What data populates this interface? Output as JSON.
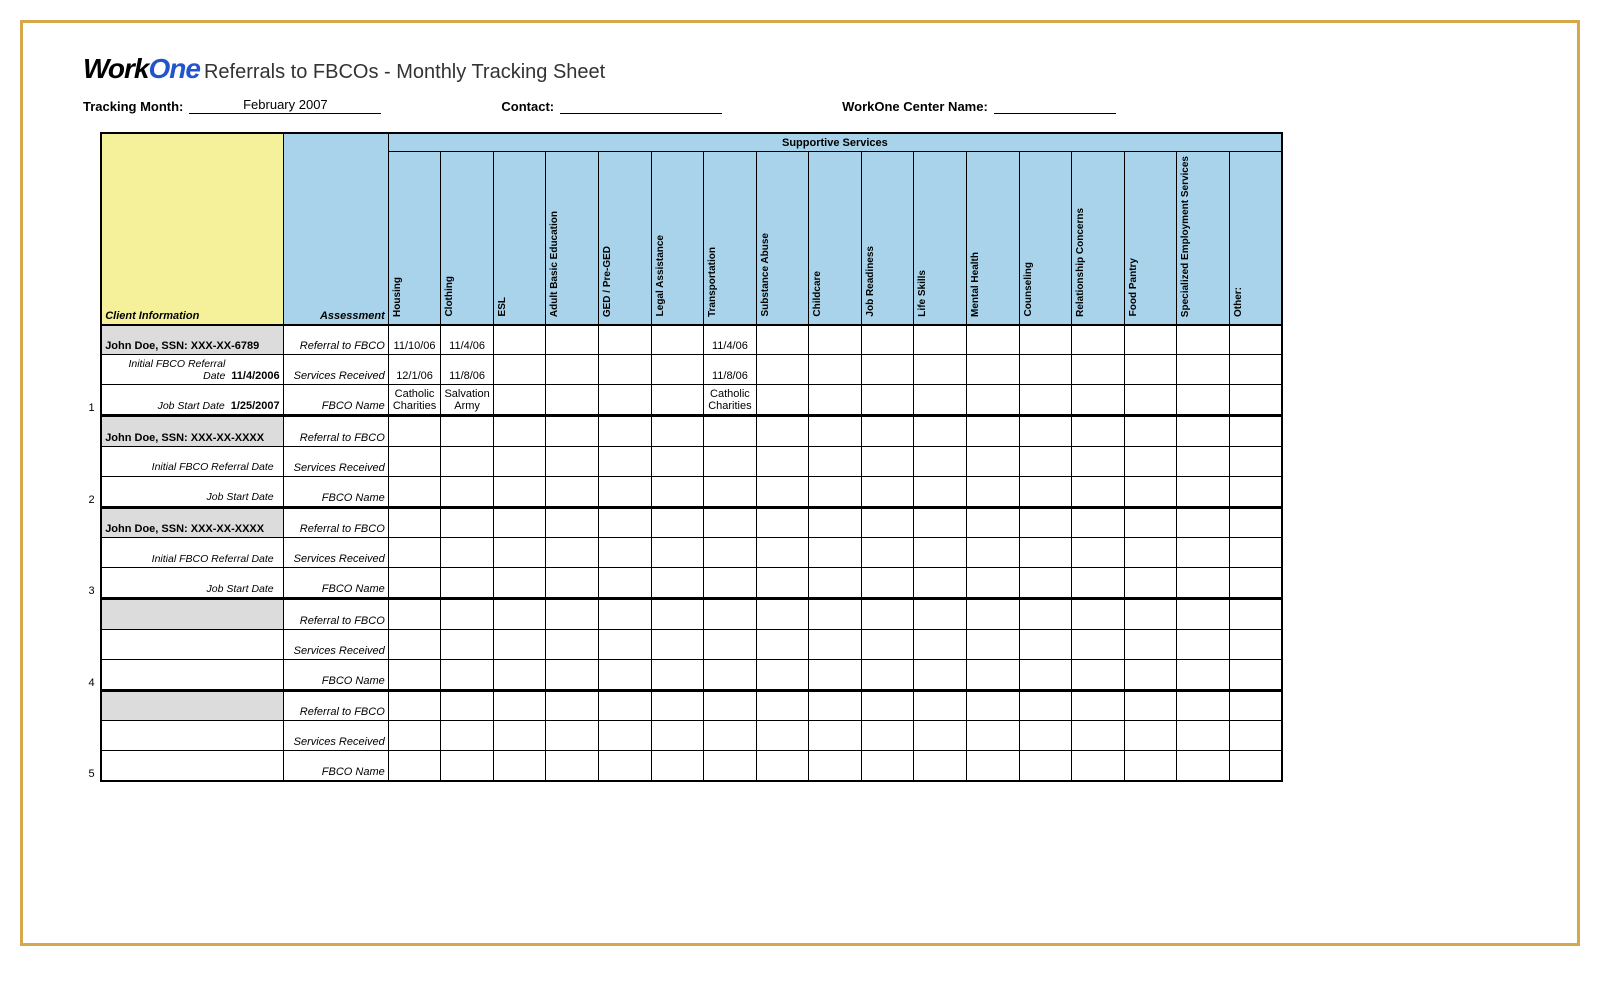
{
  "logo": {
    "work": "Work",
    "one": "One"
  },
  "title": "Referrals to FBCOs - Monthly Tracking Sheet",
  "meta": {
    "tracking_month_label": "Tracking Month:",
    "tracking_month_value": "February 2007",
    "contact_label": "Contact:",
    "contact_value": "",
    "center_label": "WorkOne Center Name:",
    "center_value": ""
  },
  "headers": {
    "supportive_services": "Supportive Services",
    "client_info": "Client Information",
    "assessment": "Assessment",
    "services": [
      "Housing",
      "Clothing",
      "ESL",
      "Adult Basic Education",
      "GED / Pre-GED",
      "Legal Assistance",
      "Transportation",
      "Substance Abuse",
      "Childcare",
      "Job Readiness",
      "Life Skills",
      "Mental Health",
      "Counseling",
      "Relationship Concerns",
      "Food Pantry",
      "Specialized Employment Services",
      "Other:"
    ]
  },
  "row_labels": {
    "referral": "Referral to FBCO",
    "services_received": "Services Received",
    "fbco_name": "FBCO Name",
    "initial_ref": "Initial FBCO Referral Date",
    "job_start": "Job Start Date"
  },
  "blocks": [
    {
      "num": "1",
      "client": "John Doe, SSN: XXX-XX-6789",
      "initial_ref_date": "11/4/2006",
      "job_start_date": "1/25/2007",
      "referral": [
        "11/10/06",
        "11/4/06",
        "",
        "",
        "",
        "",
        "11/4/06",
        "",
        "",
        "",
        "",
        "",
        "",
        "",
        "",
        "",
        ""
      ],
      "services": [
        "12/1/06",
        "11/8/06",
        "",
        "",
        "",
        "",
        "11/8/06",
        "",
        "",
        "",
        "",
        "",
        "",
        "",
        "",
        "",
        ""
      ],
      "fbco": [
        "Catholic Charities",
        "Salvation Army",
        "",
        "",
        "",
        "",
        "Catholic Charities",
        "",
        "",
        "",
        "",
        "",
        "",
        "",
        "",
        "",
        ""
      ]
    },
    {
      "num": "2",
      "client": "John Doe, SSN: XXX-XX-XXXX",
      "initial_ref_date": "",
      "job_start_date": "",
      "referral": [
        "",
        "",
        "",
        "",
        "",
        "",
        "",
        "",
        "",
        "",
        "",
        "",
        "",
        "",
        "",
        "",
        ""
      ],
      "services": [
        "",
        "",
        "",
        "",
        "",
        "",
        "",
        "",
        "",
        "",
        "",
        "",
        "",
        "",
        "",
        "",
        ""
      ],
      "fbco": [
        "",
        "",
        "",
        "",
        "",
        "",
        "",
        "",
        "",
        "",
        "",
        "",
        "",
        "",
        "",
        "",
        ""
      ]
    },
    {
      "num": "3",
      "client": "John Doe, SSN: XXX-XX-XXXX",
      "initial_ref_date": "",
      "job_start_date": "",
      "referral": [
        "",
        "",
        "",
        "",
        "",
        "",
        "",
        "",
        "",
        "",
        "",
        "",
        "",
        "",
        "",
        "",
        ""
      ],
      "services": [
        "",
        "",
        "",
        "",
        "",
        "",
        "",
        "",
        "",
        "",
        "",
        "",
        "",
        "",
        "",
        "",
        ""
      ],
      "fbco": [
        "",
        "",
        "",
        "",
        "",
        "",
        "",
        "",
        "",
        "",
        "",
        "",
        "",
        "",
        "",
        "",
        ""
      ]
    },
    {
      "num": "4",
      "client": "",
      "initial_ref_date": "",
      "job_start_date": "",
      "referral": [
        "",
        "",
        "",
        "",
        "",
        "",
        "",
        "",
        "",
        "",
        "",
        "",
        "",
        "",
        "",
        "",
        ""
      ],
      "services": [
        "",
        "",
        "",
        "",
        "",
        "",
        "",
        "",
        "",
        "",
        "",
        "",
        "",
        "",
        "",
        "",
        ""
      ],
      "fbco": [
        "",
        "",
        "",
        "",
        "",
        "",
        "",
        "",
        "",
        "",
        "",
        "",
        "",
        "",
        "",
        "",
        ""
      ]
    },
    {
      "num": "5",
      "client": "",
      "initial_ref_date": "",
      "job_start_date": "",
      "referral": [
        "",
        "",
        "",
        "",
        "",
        "",
        "",
        "",
        "",
        "",
        "",
        "",
        "",
        "",
        "",
        "",
        ""
      ],
      "services": [
        "",
        "",
        "",
        "",
        "",
        "",
        "",
        "",
        "",
        "",
        "",
        "",
        "",
        "",
        "",
        "",
        ""
      ],
      "fbco": [
        "",
        "",
        "",
        "",
        "",
        "",
        "",
        "",
        "",
        "",
        "",
        "",
        "",
        "",
        "",
        "",
        ""
      ]
    }
  ]
}
